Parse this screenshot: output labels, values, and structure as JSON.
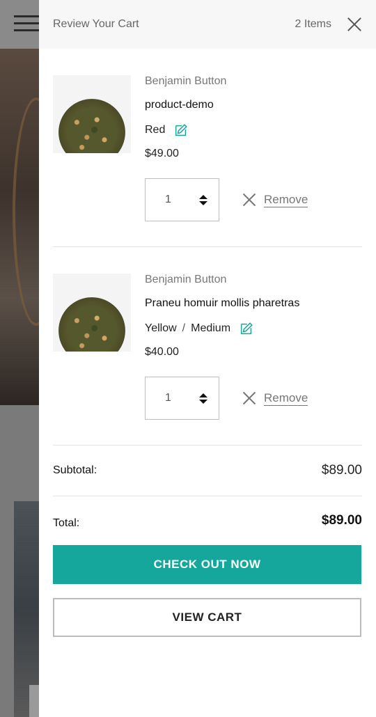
{
  "drawer": {
    "title": "Review Your Cart",
    "count": "2 Items"
  },
  "items": [
    {
      "vendor": "Benjamin Button",
      "name": "product-demo",
      "variant": [
        "Red"
      ],
      "price": "$49.00",
      "quantity": "1",
      "remove_label": "Remove"
    },
    {
      "vendor": "Benjamin Button",
      "name": "Praneu homuir mollis pharetras",
      "variant": [
        "Yellow",
        "Medium"
      ],
      "variant_separator": "/",
      "price": "$40.00",
      "quantity": "1",
      "remove_label": "Remove"
    }
  ],
  "summary": {
    "subtotal_label": "Subtotal:",
    "subtotal_value": "$89.00",
    "total_label": "Total:",
    "total_value": "$89.00"
  },
  "actions": {
    "checkout_label": "CHECK OUT NOW",
    "view_cart_label": "VIEW CART"
  },
  "colors": {
    "accent": "#16a79c",
    "overlay": "#7a7a7a"
  }
}
